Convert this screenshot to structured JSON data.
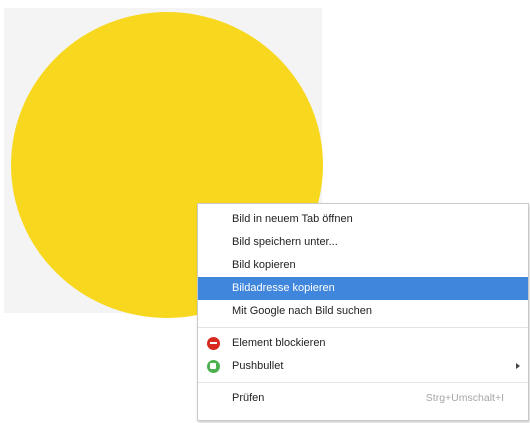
{
  "image": {
    "circle_color": "#f8d81e",
    "icon": "yellow-circle-image"
  },
  "context_menu": {
    "highlight_color": "#3f86dc",
    "groups": [
      [
        {
          "label": "Bild in neuem Tab öffnen"
        },
        {
          "label": "Bild speichern unter..."
        },
        {
          "label": "Bild kopieren"
        },
        {
          "label": "Bildadresse kopieren",
          "highlighted": true
        },
        {
          "label": "Mit Google nach Bild suchen"
        }
      ],
      [
        {
          "label": "Element blockieren",
          "icon": "adblock-plus-icon",
          "icon_color": "#d72b1f"
        },
        {
          "label": "Pushbullet",
          "icon": "pushbullet-icon",
          "icon_color": "#4cb050",
          "submenu": true
        }
      ],
      [
        {
          "label": "Prüfen",
          "shortcut": "Strg+Umschalt+I"
        }
      ]
    ]
  }
}
